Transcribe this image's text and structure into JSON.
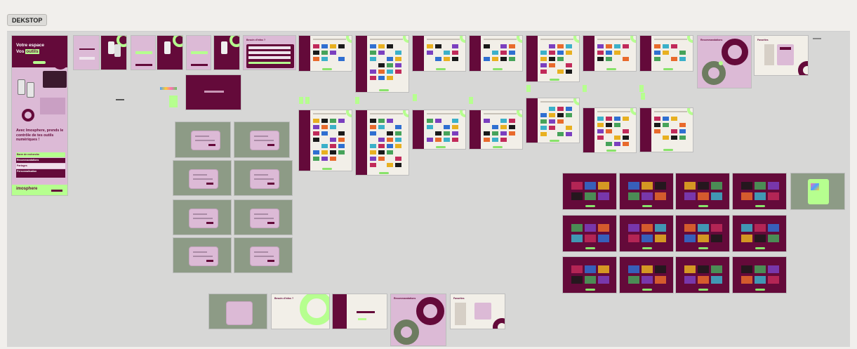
{
  "frame": {
    "label": "DEKSTOP"
  },
  "hero": {
    "title_line1": "Votre espace",
    "title_line2_prefix": "Vos",
    "title_line2_highlight": "outils",
    "tagline": "Avec Imosphere, prends le contrôle de tes outils numériques !",
    "menu": [
      "Barre de recherche",
      "Recommandations",
      "Partages",
      "Personnalisation"
    ],
    "brand": "imosphere"
  },
  "modal_titles": {
    "search": "Besoin d'infos ?",
    "recommend": "Recommandations",
    "favorites": "Favorites"
  },
  "colors": {
    "wine": "#640a3a",
    "pink": "#dcbad6",
    "lime": "#b6ff8f",
    "sage": "#8d9b86",
    "cream": "#f2efe8"
  }
}
